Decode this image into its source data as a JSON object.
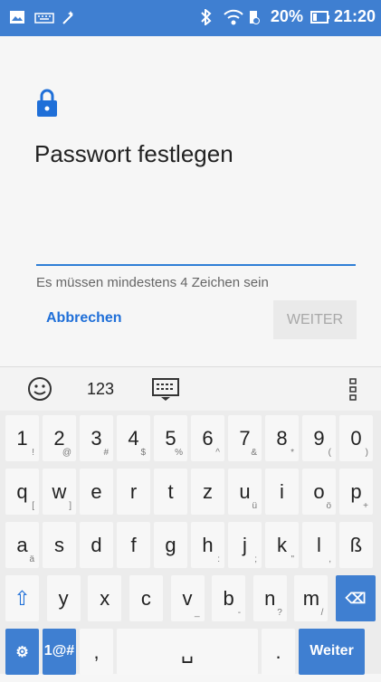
{
  "status_bar": {
    "left_icons": [
      "image-icon",
      "keyboard-icon",
      "magic-icon"
    ],
    "right_icons": [
      "bluetooth-icon",
      "wifi-icon",
      "battery-saver-icon",
      "battery-icon"
    ],
    "battery_text": "20%",
    "time": "21:20"
  },
  "dialog": {
    "title": "Passwort festlegen",
    "hint": "Es müssen mindestens 4 Zeichen sein",
    "cancel_label": "Abbrechen",
    "next_label": "WEITER"
  },
  "keyboard": {
    "toolbar": {
      "numeric_label": "123"
    },
    "rows": [
      [
        {
          "k": "1",
          "s": "!"
        },
        {
          "k": "2",
          "s": "@"
        },
        {
          "k": "3",
          "s": "#"
        },
        {
          "k": "4",
          "s": "$"
        },
        {
          "k": "5",
          "s": "%"
        },
        {
          "k": "6",
          "s": "^"
        },
        {
          "k": "7",
          "s": "&"
        },
        {
          "k": "8",
          "s": "*"
        },
        {
          "k": "9",
          "s": "("
        },
        {
          "k": "0",
          "s": ")"
        }
      ],
      [
        {
          "k": "q",
          "s": "["
        },
        {
          "k": "w",
          "s": "]"
        },
        {
          "k": "e",
          "s": ""
        },
        {
          "k": "r",
          "s": ""
        },
        {
          "k": "t",
          "s": ""
        },
        {
          "k": "z",
          "s": ""
        },
        {
          "k": "u",
          "s": "ü"
        },
        {
          "k": "i",
          "s": ""
        },
        {
          "k": "o",
          "s": "ö"
        },
        {
          "k": "p",
          "s": "+"
        }
      ],
      [
        {
          "k": "a",
          "s": "ä"
        },
        {
          "k": "s",
          "s": ""
        },
        {
          "k": "d",
          "s": ""
        },
        {
          "k": "f",
          "s": ""
        },
        {
          "k": "g",
          "s": ""
        },
        {
          "k": "h",
          "s": ":"
        },
        {
          "k": "j",
          "s": ";"
        },
        {
          "k": "k",
          "s": "\""
        },
        {
          "k": "l",
          "s": ","
        },
        {
          "k": "ß",
          "s": ""
        }
      ],
      [
        {
          "k": "⇧",
          "s": ""
        },
        {
          "k": "y",
          "s": ""
        },
        {
          "k": "x",
          "s": ""
        },
        {
          "k": "c",
          "s": ""
        },
        {
          "k": "v",
          "s": "_"
        },
        {
          "k": "b",
          "s": "-"
        },
        {
          "k": "n",
          "s": "?"
        },
        {
          "k": "m",
          "s": "/"
        },
        {
          "k": "⌫",
          "s": ""
        }
      ]
    ],
    "bottom_row": {
      "settings_icon": "gear-icon",
      "symbols_label": "1@#",
      "comma": ",",
      "space_label": "␣",
      "period": ".",
      "enter_label": "Weiter"
    }
  }
}
